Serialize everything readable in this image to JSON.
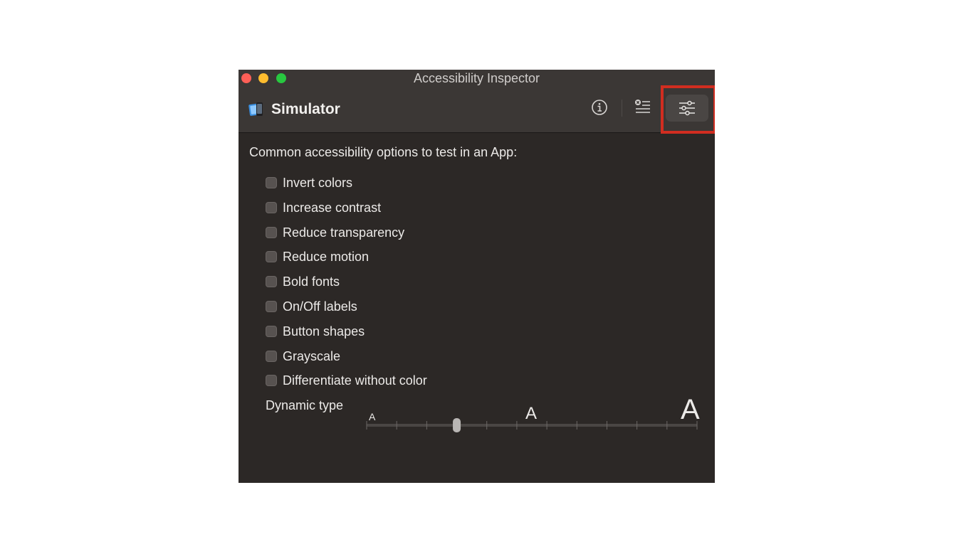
{
  "window": {
    "title": "Accessibility Inspector",
    "target": "Simulator"
  },
  "toolbar": {
    "buttons": [
      {
        "name": "inspection",
        "icon": "info-icon"
      },
      {
        "name": "audit",
        "icon": "audit-list-icon"
      },
      {
        "name": "settings",
        "icon": "sliders-icon",
        "selected": true
      }
    ]
  },
  "settings": {
    "heading": "Common accessibility options to test in an App:",
    "options": [
      {
        "label": "Invert colors",
        "checked": false
      },
      {
        "label": "Increase contrast",
        "checked": false
      },
      {
        "label": "Reduce transparency",
        "checked": false
      },
      {
        "label": "Reduce motion",
        "checked": false
      },
      {
        "label": "Bold fonts",
        "checked": false
      },
      {
        "label": "On/Off labels",
        "checked": false
      },
      {
        "label": "Button shapes",
        "checked": false
      },
      {
        "label": "Grayscale",
        "checked": false
      },
      {
        "label": "Differentiate without color",
        "checked": false
      }
    ],
    "dynamic_type": {
      "label": "Dynamic type",
      "small_glyph": "A",
      "medium_glyph": "A",
      "large_glyph": "A",
      "steps": 12,
      "value_step": 3
    }
  },
  "colors": {
    "close": "#fe5f57",
    "minimize": "#febc2e",
    "zoom": "#28c840",
    "highlight": "#d12d20"
  }
}
